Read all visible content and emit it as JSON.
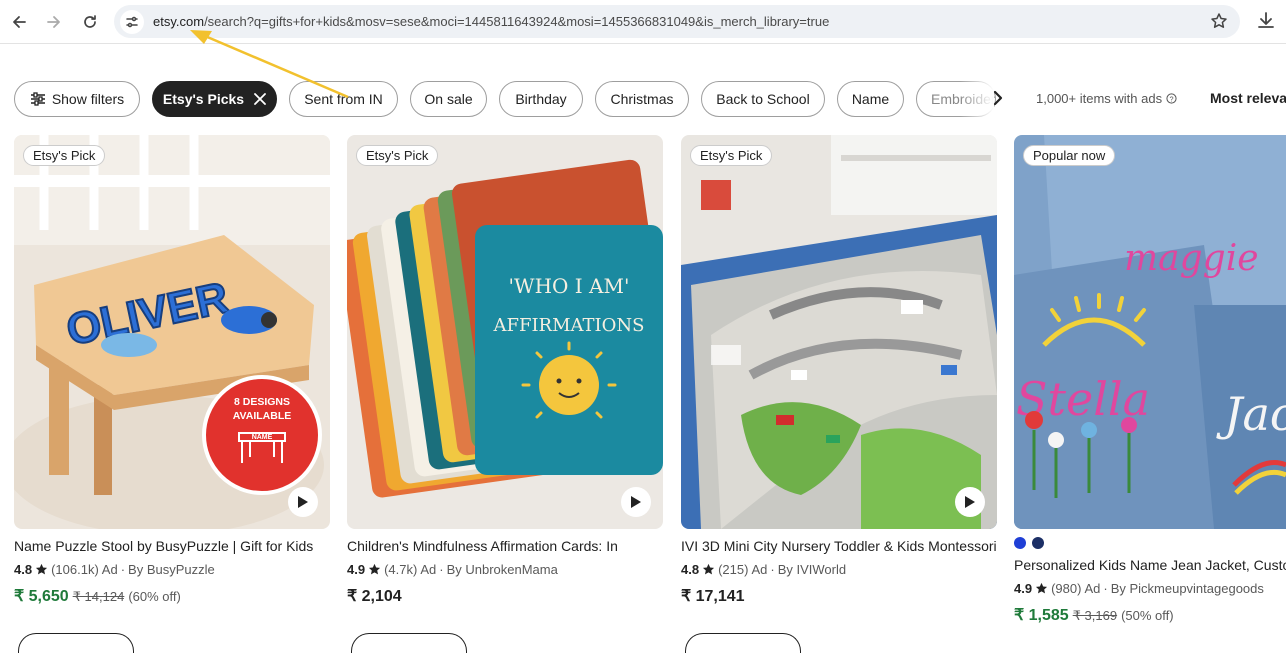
{
  "browser": {
    "url_domain": "etsy.com",
    "url_path": "/search?q=gifts+for+kids&mosv=sese&moci=1445811643924&mosi=1455366831049&is_merch_library=true",
    "icons": [
      "back-arrow-icon",
      "forward-arrow-icon",
      "reload-icon",
      "site-settings-icon",
      "star-bookmark-icon",
      "download-icon"
    ]
  },
  "filters": {
    "show_filters_label": "Show filters",
    "chips": [
      "Etsy's Picks",
      "Sent from IN",
      "On sale",
      "Birthday",
      "Christmas",
      "Back to School",
      "Name",
      "Embroidered"
    ],
    "results_text": "1,000+ items with ads",
    "sort_label": "Most relevant"
  },
  "listings": [
    {
      "badge": "Etsy's Pick",
      "title": "Name Puzzle Stool by BusyPuzzle | Gift for Kids",
      "rating": "4.8",
      "reviews": "(106.1k)",
      "ad": "Ad",
      "shop": "By BusyPuzzle",
      "price": "₹ 5,650",
      "original_price": "₹ 14,124",
      "discount": "(60% off)",
      "image_text": [
        "8 DESIGNS",
        "AVAILABLE",
        "NAME",
        "OLIVER"
      ]
    },
    {
      "badge": "Etsy's Pick",
      "title": "Children's Mindfulness Affirmation Cards: In",
      "rating": "4.9",
      "reviews": "(4.7k)",
      "ad": "Ad",
      "shop": "By UnbrokenMama",
      "price": "₹ 2,104",
      "image_text": [
        "'WHO I AM'",
        "AFFIRMATIONS"
      ]
    },
    {
      "badge": "Etsy's Pick",
      "title": "IVI 3D Mini City Nursery Toddler & Kids Montessori",
      "rating": "4.8",
      "reviews": "(215)",
      "ad": "Ad",
      "shop": "By IVIWorld",
      "price": "₹ 17,141"
    },
    {
      "badge": "Popular now",
      "title": "Personalized Kids Name Jean Jacket, Custom",
      "rating": "4.9",
      "reviews": "(980)",
      "ad": "Ad",
      "shop": "By Pickmeupvintagegoods",
      "price": "₹ 1,585",
      "original_price": "₹ 3,169",
      "discount": "(50% off)",
      "swatch_colors": [
        "#1f3fd6",
        "#1c2f66"
      ],
      "image_text": [
        "maggie",
        "Stella",
        "Jac"
      ]
    }
  ],
  "colors": {
    "sale_green": "#1f7a3a",
    "annotation_arrow": "#f2c12e"
  }
}
